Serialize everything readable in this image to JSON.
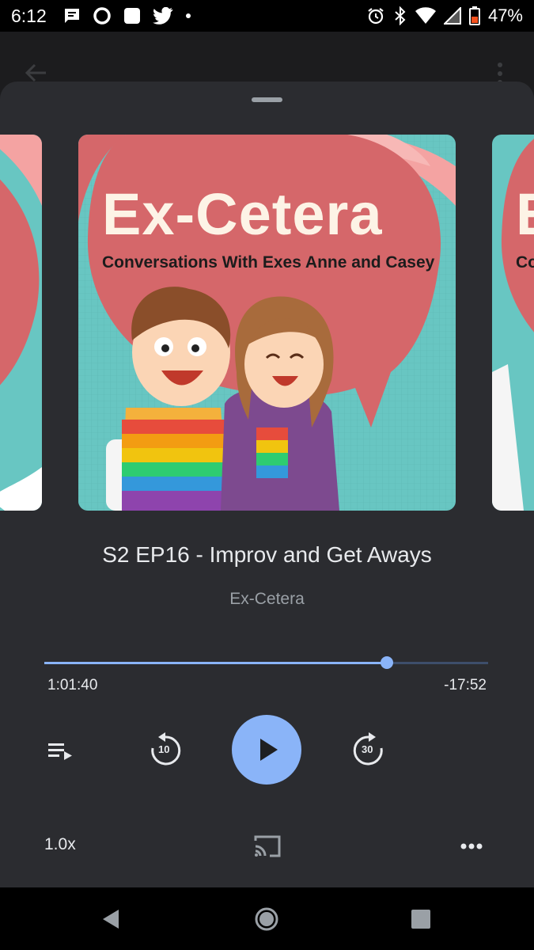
{
  "status_bar": {
    "time": "6:12",
    "battery_percent": "47%",
    "notification_icons": [
      "message-icon",
      "circle-app-icon",
      "square-app-icon",
      "twitter-icon",
      "dot-icon"
    ],
    "system_icons": [
      "alarm-icon",
      "bluetooth-icon",
      "wifi-icon",
      "cell-signal-icon",
      "battery-icon"
    ]
  },
  "artwork": {
    "title": "Ex-Cetera",
    "subtitle": "Conversations With Exes Anne and Casey",
    "colors": {
      "background": "#68c6c2",
      "bubble": "#d5676a",
      "title": "#fdf3e6"
    }
  },
  "episode": {
    "title": "S2 EP16 - Improv and Get Aways",
    "show": "Ex-Cetera"
  },
  "progress": {
    "elapsed": "1:01:40",
    "remaining": "-17:52",
    "fraction": 0.771
  },
  "controls": {
    "rewind_seconds": "10",
    "forward_seconds": "30",
    "speed": "1.0x"
  },
  "colors": {
    "accent": "#8ab4f8",
    "sheet": "#2b2c30"
  }
}
